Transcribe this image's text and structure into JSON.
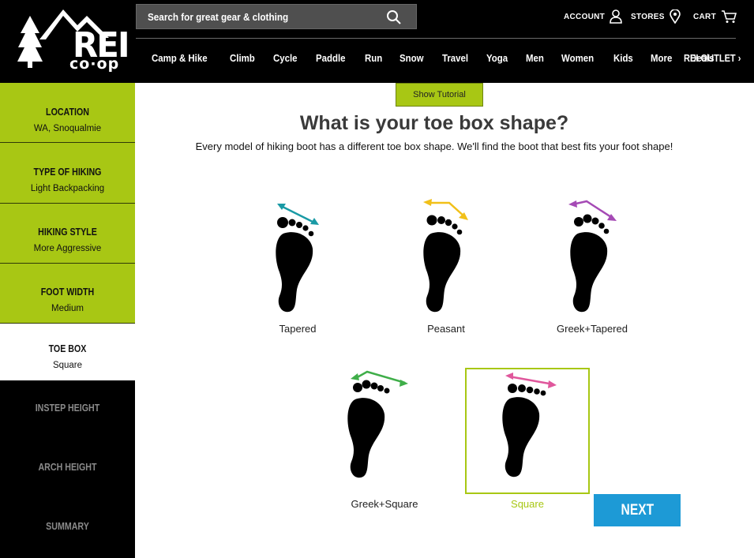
{
  "header": {
    "logo_text": "REI",
    "logo_sub": "co·op",
    "search_placeholder": "Search for great gear & clothing",
    "account_label": "ACCOUNT",
    "stores_label": "STORES",
    "cart_label": "CART",
    "nav": [
      "Camp & Hike",
      "Climb",
      "Cycle",
      "Paddle",
      "Run",
      "Snow",
      "Travel",
      "Yoga",
      "Men",
      "Women",
      "Kids",
      "More",
      "Deals"
    ],
    "outlet_label": "REI OUTLET"
  },
  "sidebar": {
    "steps": [
      {
        "title": "LOCATION",
        "value": "WA, Snoqualmie",
        "state": "done"
      },
      {
        "title": "TYPE OF HIKING",
        "value": "Light Backpacking",
        "state": "done"
      },
      {
        "title": "HIKING STYLE",
        "value": "More Aggressive",
        "state": "done"
      },
      {
        "title": "FOOT WIDTH",
        "value": "Medium",
        "state": "done"
      },
      {
        "title": "TOE BOX",
        "value": "Square",
        "state": "active"
      },
      {
        "title": "INSTEP HEIGHT",
        "value": "",
        "state": "pending"
      },
      {
        "title": "ARCH HEIGHT",
        "value": "",
        "state": "pending"
      },
      {
        "title": "SUMMARY",
        "value": "",
        "state": "pending"
      }
    ]
  },
  "main": {
    "tutorial_label": "Show Tutorial",
    "question": "What is your toe box shape?",
    "subtitle": "Every model of hiking boot has a different toe box shape. We'll find the boot that best fits your foot shape!",
    "options": [
      {
        "label": "Tapered",
        "arrow_color": "#1a9aa5",
        "selected": false
      },
      {
        "label": "Peasant",
        "arrow_color": "#f1c019",
        "selected": false
      },
      {
        "label": "Greek+Tapered",
        "arrow_color": "#a54ab5",
        "selected": false
      },
      {
        "label": "Greek+Square",
        "arrow_color": "#3fae49",
        "selected": false
      },
      {
        "label": "Square",
        "arrow_color": "#e0579c",
        "selected": true
      }
    ],
    "next_label": "NEXT"
  },
  "colors": {
    "brand_green": "#a8c714",
    "next_blue": "#1d9ad6",
    "header_black": "#000000"
  }
}
